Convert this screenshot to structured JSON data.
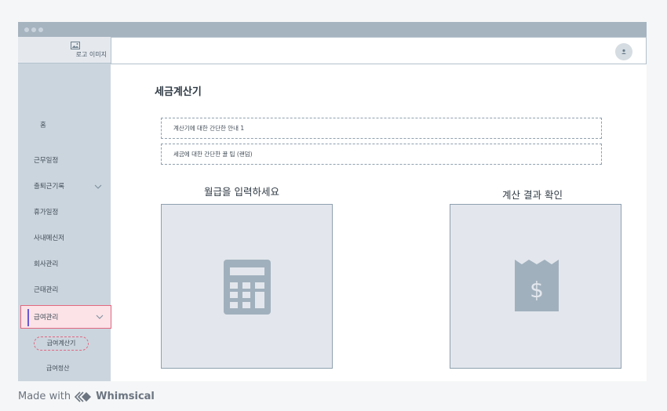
{
  "sidebar": {
    "logo_text": "로고 이미지",
    "items": [
      {
        "label": "홈"
      },
      {
        "label": "근무일정"
      },
      {
        "label": "출퇴근기록"
      },
      {
        "label": "휴가일정"
      },
      {
        "label": "사내메신저"
      },
      {
        "label": "회사관리"
      },
      {
        "label": "근태관리"
      },
      {
        "label": "급여관리"
      }
    ],
    "subitems": [
      {
        "label": "급여계산기"
      },
      {
        "label": "급여정산"
      }
    ]
  },
  "main": {
    "title": "세금계산기",
    "info_lines": [
      "계산기에 대한 간단한 안내 1",
      "세금에 대한 간단한 꿀 팁 (랜덤)"
    ],
    "input_section": {
      "title": "월급을 입력하세요",
      "icon": "calculator-icon"
    },
    "result_section": {
      "title": "계산 결과 확인",
      "icon": "receipt-dollar-icon"
    }
  },
  "footer": {
    "made_with": "Made with",
    "brand": "Whimsical"
  },
  "colors": {
    "accent_pink": "#e2677f",
    "accent_purple": "#6a56d6",
    "panel_icon": "#a1b0bd"
  }
}
